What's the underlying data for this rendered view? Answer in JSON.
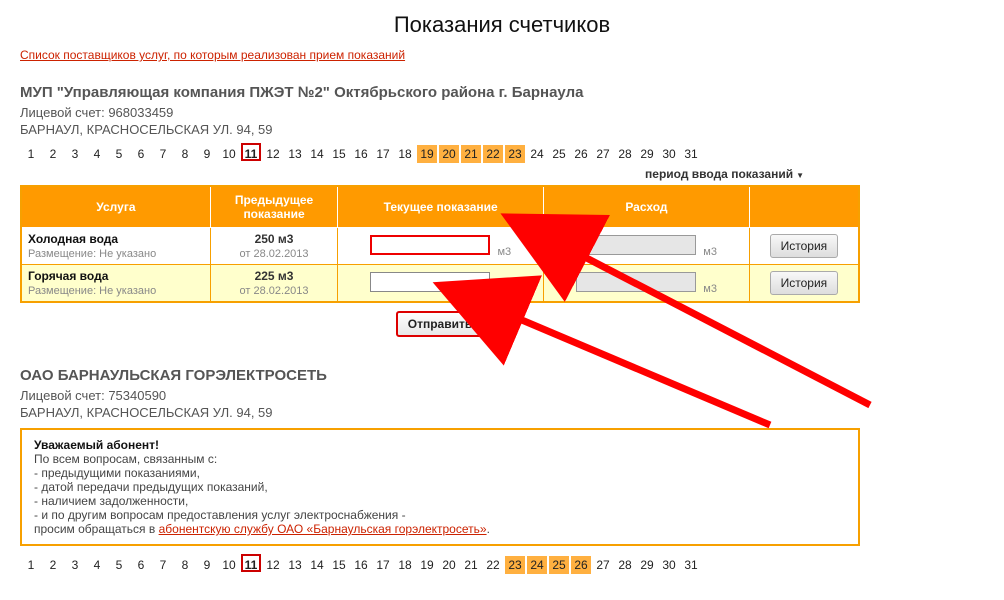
{
  "page_title": "Показания счетчиков",
  "providers_link": "Список поставщиков услуг, по которым реализован прием показаний",
  "company1": {
    "name": "МУП \"Управляющая компания ПЖЭТ №2\" Октябрьского района г. Барнаула",
    "account_label": "Лицевой счет:",
    "account_no": "968033459",
    "address": "БАРНАУЛ, КРАСНОСЕЛЬСКАЯ УЛ. 94, 59",
    "period_label": "период ввода показаний",
    "calendar": {
      "days": [
        "1",
        "2",
        "3",
        "4",
        "5",
        "6",
        "7",
        "8",
        "9",
        "10",
        "11",
        "12",
        "13",
        "14",
        "15",
        "16",
        "17",
        "18",
        "19",
        "20",
        "21",
        "22",
        "23",
        "24",
        "25",
        "26",
        "27",
        "28",
        "29",
        "30",
        "31"
      ],
      "current": "11",
      "highlighted": [
        "19",
        "20",
        "21",
        "22",
        "23"
      ]
    },
    "table": {
      "headers": [
        "Услуга",
        "Предыдущее\nпоказание",
        "Текущее показание",
        "Расход",
        ""
      ],
      "rows": [
        {
          "service": "Холодная вода",
          "placement": "Размещение: Не указано",
          "prev_value": "250 м3",
          "prev_date": "от 28.02.2013",
          "unit": "м3",
          "history": "История"
        },
        {
          "service": "Горячая вода",
          "placement": "Размещение: Не указано",
          "prev_value": "225 м3",
          "prev_date": "от 28.02.2013",
          "unit": "м3",
          "history": "История"
        }
      ]
    },
    "submit": "Отправить"
  },
  "company2": {
    "name": "ОАО БАРНАУЛЬСКАЯ ГОРЭЛЕКТРОСЕТЬ",
    "account_label": "Лицевой счет:",
    "account_no": "75340590",
    "address": "БАРНАУЛ, КРАСНОСЕЛЬСКАЯ УЛ. 94, 59",
    "notice": {
      "greeting": "Уважаемый абонент!",
      "l1": "По всем вопросам, связанным с:",
      "l2": "- предыдущими показаниями,",
      "l3": "- датой передачи предыдущих показаний,",
      "l4": "- наличием задолженности,",
      "l5": "- и по другим вопросам предоставления услуг электроснабжения -",
      "l6a": "просим обращаться в ",
      "l6link": "абонентскую службу ОАО «Барнаульская горэлектросеть»",
      "l6b": "."
    },
    "calendar": {
      "days": [
        "1",
        "2",
        "3",
        "4",
        "5",
        "6",
        "7",
        "8",
        "9",
        "10",
        "11",
        "12",
        "13",
        "14",
        "15",
        "16",
        "17",
        "18",
        "19",
        "20",
        "21",
        "22",
        "23",
        "24",
        "25",
        "26",
        "27",
        "28",
        "29",
        "30",
        "31"
      ],
      "current": "11",
      "highlighted": [
        "23",
        "24",
        "25",
        "26"
      ]
    }
  }
}
